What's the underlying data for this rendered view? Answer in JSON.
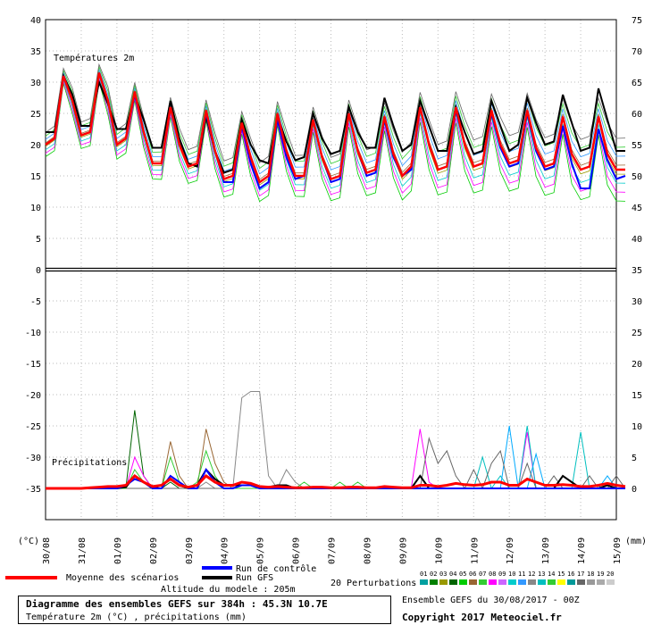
{
  "chart_data": [
    {
      "type": "line",
      "title": "Températures 2m",
      "ylabel_left": "(°C)",
      "ylim": [
        0,
        40
      ],
      "yticks_left": [
        0,
        5,
        10,
        15,
        20,
        25,
        30,
        35,
        40
      ],
      "x": [
        "30/08",
        "31/08",
        "01/09",
        "02/09",
        "03/09",
        "04/09",
        "05/09",
        "06/09",
        "07/09",
        "08/09",
        "09/09",
        "10/09",
        "11/09",
        "12/09",
        "13/09",
        "14/09",
        "15/09"
      ],
      "step_hours": 6,
      "series": [
        {
          "name": "Moyenne des scénarios",
          "color": "#ff0000",
          "values": [
            20,
            21,
            31,
            27,
            21.5,
            22,
            31.5,
            27,
            20,
            21,
            28.5,
            22,
            17,
            17,
            26,
            20,
            16.5,
            17,
            25.5,
            19,
            14.5,
            15,
            23.5,
            18,
            14,
            15,
            25,
            19,
            15,
            15,
            24,
            18,
            14.5,
            15,
            25,
            19,
            15.5,
            16,
            24.5,
            18.5,
            15,
            16.5,
            26,
            20,
            16,
            16.5,
            26,
            20,
            16.5,
            17,
            25.5,
            20,
            17,
            17.5,
            25.5,
            19.5,
            16.5,
            17,
            24.5,
            18.5,
            16,
            16.5,
            24.5,
            18.5,
            16,
            16
          ]
        },
        {
          "name": "Run de contrôle",
          "color": "#0000ff",
          "values": [
            20,
            21,
            31,
            27,
            21.5,
            22,
            31.5,
            27,
            20,
            21,
            28,
            22,
            17,
            17,
            26,
            20,
            16.5,
            17,
            25,
            19,
            14,
            14,
            23,
            17,
            13,
            14,
            24,
            18,
            14.5,
            15,
            24,
            18,
            14,
            14.5,
            25,
            19,
            15,
            15.5,
            24,
            18,
            15,
            16,
            26,
            20,
            16,
            16.5,
            25.5,
            20,
            16.5,
            17,
            25,
            19.5,
            16.5,
            17,
            25,
            19,
            16,
            16.5,
            23,
            17,
            13,
            13,
            22.5,
            17.5,
            14.5,
            15
          ]
        },
        {
          "name": "Run GFS",
          "color": "#000000",
          "values": [
            22,
            22,
            31,
            28,
            23,
            23,
            30,
            26.5,
            22.5,
            22.5,
            28,
            24,
            19.5,
            19.5,
            27,
            21,
            17,
            16.5,
            24.5,
            19,
            15.5,
            16,
            24,
            20,
            17.5,
            17,
            24.5,
            20.5,
            17.5,
            18,
            25,
            21,
            18.5,
            19,
            26,
            22,
            19.5,
            19.5,
            27.5,
            23,
            19,
            20,
            27,
            23,
            19,
            19,
            26,
            22,
            18.5,
            19,
            27,
            23,
            19,
            20,
            27.5,
            23.5,
            20,
            20.5,
            28,
            23.5,
            19,
            19.5,
            29,
            24,
            19,
            19
          ]
        }
      ]
    },
    {
      "type": "line",
      "title": "Précipitations",
      "ylabel_right": "(mm)",
      "ylim": [
        0,
        35
      ],
      "yticks_right": [
        0,
        5,
        10,
        15,
        20,
        25,
        30,
        35
      ],
      "series": [
        {
          "name": "Moyenne des scénarios",
          "color": "#ff0000",
          "values": [
            0,
            0,
            0,
            0,
            0,
            0.1,
            0.2,
            0.3,
            0.3,
            0.5,
            2,
            1,
            0.3,
            0.5,
            1.5,
            0.5,
            0.2,
            0.5,
            2,
            1,
            0.5,
            0.5,
            1,
            0.8,
            0.3,
            0.2,
            0.3,
            0.2,
            0.1,
            0.1,
            0.2,
            0.2,
            0.1,
            0.1,
            0.2,
            0.2,
            0.1,
            0.1,
            0.3,
            0.2,
            0.1,
            0.1,
            0.5,
            0.5,
            0.3,
            0.5,
            0.8,
            0.6,
            0.5,
            0.6,
            1,
            1,
            0.5,
            0.5,
            1.5,
            1,
            0.5,
            0.5,
            0.6,
            0.5,
            0.3,
            0.3,
            0.5,
            0.8,
            0.5,
            0.3
          ]
        },
        {
          "name": "Run de contrôle",
          "color": "#0000ff",
          "values": [
            0,
            0,
            0,
            0,
            0,
            0,
            0,
            0,
            0,
            0.5,
            1.5,
            1,
            0,
            0,
            2,
            1,
            0,
            0,
            3,
            1,
            0,
            0,
            0.5,
            0.5,
            0,
            0,
            0,
            0,
            0,
            0,
            0,
            0,
            0,
            0,
            0,
            0,
            0,
            0,
            0,
            0,
            0,
            0,
            0,
            0,
            0,
            0,
            0,
            0,
            0,
            0,
            0,
            0,
            0,
            0,
            0,
            0,
            0,
            0,
            0,
            0,
            0,
            0,
            0,
            0,
            0,
            0
          ]
        },
        {
          "name": "Run GFS",
          "color": "#000000",
          "values": [
            0,
            0,
            0,
            0,
            0,
            0,
            0,
            0,
            0,
            0.2,
            2,
            1,
            0,
            0.5,
            1.5,
            0.5,
            0,
            0.5,
            3,
            1.5,
            0.5,
            0.5,
            0.5,
            0.5,
            0.3,
            0.2,
            0.5,
            0.5,
            0,
            0,
            0,
            0,
            0,
            0,
            0,
            0,
            0,
            0,
            0,
            0,
            0,
            0,
            2,
            0,
            0,
            0,
            0,
            0,
            0,
            0,
            0,
            0,
            0,
            0,
            0,
            0,
            0,
            0,
            2,
            1,
            0,
            0,
            0,
            0.5,
            0,
            0
          ]
        },
        {
          "name": "Perturbation 12",
          "color": "#888888",
          "values": [
            0,
            0,
            0,
            0,
            0,
            0,
            0,
            0,
            0,
            0,
            0,
            0,
            0,
            0,
            0,
            0,
            0,
            0,
            1,
            0,
            0,
            0,
            14.5,
            15.5,
            15.5,
            2,
            0,
            3,
            1,
            0,
            0,
            0,
            0,
            0,
            0,
            0,
            0,
            0,
            0,
            0,
            0,
            0,
            0,
            0,
            0,
            0,
            0,
            0,
            0,
            0,
            0,
            0,
            0,
            0,
            0,
            0,
            0,
            0,
            0,
            0,
            0,
            0,
            0,
            0,
            0,
            0
          ]
        },
        {
          "name": "Perturbation 02",
          "color": "#006400",
          "values": [
            0,
            0,
            0,
            0,
            0,
            0,
            0,
            0,
            0,
            0,
            12.5,
            2,
            0,
            0,
            1,
            0,
            0,
            0,
            0,
            0,
            0,
            0,
            0,
            0,
            0,
            0,
            0,
            0,
            0,
            0,
            0,
            0,
            0,
            0,
            0,
            0,
            0,
            0,
            0,
            0,
            0,
            0,
            0,
            0,
            0,
            0,
            0,
            0,
            0,
            0,
            0,
            0,
            0,
            0,
            0,
            0,
            0,
            0,
            0,
            0,
            0,
            0,
            0,
            0,
            0,
            0
          ]
        },
        {
          "name": "Perturbation 04",
          "color": "#996633",
          "values": [
            0,
            0,
            0,
            0,
            0,
            0,
            0,
            0,
            0,
            0,
            2,
            1,
            0,
            0,
            7.5,
            2,
            0,
            0,
            9.5,
            4,
            1,
            0,
            0,
            0,
            0,
            0,
            0,
            0,
            0,
            0,
            0,
            0,
            0,
            0,
            0,
            0,
            0,
            0,
            0,
            0,
            0,
            0,
            0,
            0,
            0,
            0,
            0,
            0,
            0,
            0,
            0,
            0,
            0,
            0,
            0,
            0,
            0,
            0,
            0,
            0,
            0,
            0,
            0,
            0,
            0,
            0
          ]
        },
        {
          "name": "Perturbation 08",
          "color": "#ff00ff",
          "values": [
            0,
            0,
            0,
            0,
            0,
            0,
            0,
            0,
            0,
            0,
            5,
            2,
            0,
            0,
            0,
            0,
            0,
            0,
            0,
            0,
            0,
            0,
            0,
            0,
            0,
            0,
            0,
            0,
            0,
            0,
            0,
            0,
            0,
            0,
            0,
            0,
            0,
            0,
            0,
            0,
            0,
            0,
            9.5,
            1,
            0,
            0,
            0,
            0,
            0,
            0,
            0,
            0,
            0,
            0,
            9,
            0,
            0,
            0,
            0,
            0,
            0,
            0,
            0,
            0,
            0,
            0
          ]
        },
        {
          "name": "Perturbation 13",
          "color": "#00bfbf",
          "values": [
            0,
            0,
            0,
            0,
            0,
            0,
            0,
            0,
            0,
            0,
            0,
            0,
            0,
            0,
            0,
            0,
            0,
            0,
            0,
            0,
            0,
            0,
            0,
            0,
            0,
            0,
            0,
            0,
            0,
            0,
            0,
            0,
            0,
            0,
            0,
            0,
            0,
            0,
            0,
            0,
            0,
            0,
            0,
            0,
            0,
            0,
            0,
            0,
            0,
            5,
            0,
            2,
            0,
            0,
            10,
            0,
            0,
            0,
            0,
            0,
            9,
            0,
            0,
            0,
            0,
            0
          ]
        },
        {
          "name": "Perturbation 11",
          "color": "#00aaff",
          "values": [
            0,
            0,
            0,
            0,
            0,
            0,
            0,
            0,
            0,
            0,
            0,
            0,
            0,
            0,
            0,
            0,
            0,
            0,
            0,
            0,
            0,
            0,
            0,
            0,
            0,
            0,
            0,
            0,
            0,
            0,
            0,
            0,
            0,
            0,
            0,
            0,
            0,
            0,
            0,
            0,
            0,
            0,
            0,
            0,
            0,
            0,
            0,
            0,
            0,
            0,
            0,
            0,
            10,
            0,
            0,
            5.5,
            0,
            0,
            0,
            0,
            0,
            0,
            0,
            2,
            0,
            0
          ]
        },
        {
          "name": "Perturbation 17",
          "color": "#666666",
          "values": [
            0,
            0,
            0,
            0,
            0,
            0,
            0,
            0,
            0,
            0,
            0,
            0,
            0,
            0,
            0,
            0,
            0,
            0,
            0,
            0,
            0,
            0,
            0,
            0,
            0,
            0,
            0,
            0,
            0,
            0,
            0,
            0,
            0,
            0,
            0,
            0,
            0,
            0,
            0,
            0,
            0,
            0,
            0,
            8,
            4,
            6,
            2,
            0,
            3,
            0,
            4,
            6,
            0,
            0,
            4,
            0,
            0,
            2,
            0,
            0,
            0,
            2,
            0,
            0,
            2,
            0
          ]
        },
        {
          "name": "Perturbation 14",
          "color": "#33cc33",
          "values": [
            0,
            0,
            0,
            0,
            0,
            0,
            0,
            0,
            0,
            0,
            3,
            1,
            0,
            0,
            5,
            1,
            0,
            1,
            6,
            2,
            0,
            0,
            0,
            0,
            0,
            0,
            0,
            0,
            0,
            1,
            0,
            0,
            0,
            1,
            0,
            1,
            0,
            0,
            0,
            0,
            0,
            0,
            0,
            0,
            0,
            0,
            0,
            0,
            0,
            0,
            0,
            0,
            0,
            0,
            0,
            0,
            0,
            0,
            0,
            0,
            0,
            0,
            0,
            0,
            0,
            0
          ]
        }
      ]
    }
  ],
  "labels": {
    "temp_title": "Températures 2m",
    "precip_title": "Précipitations",
    "unit_left": "(°C)",
    "unit_right": "(mm)",
    "left_ticks": [
      "40",
      "35",
      "30",
      "25",
      "20",
      "15",
      "10",
      "5",
      "0",
      "-5",
      "-10",
      "-15",
      "-20",
      "-25",
      "-30",
      "-35"
    ],
    "right_ticks": [
      "75",
      "70",
      "65",
      "60",
      "55",
      "50",
      "45",
      "40",
      "35",
      "30",
      "25",
      "20",
      "15",
      "10",
      "5",
      "0"
    ],
    "dates": [
      "30/08",
      "31/08",
      "01/09",
      "02/09",
      "03/09",
      "04/09",
      "05/09",
      "06/09",
      "07/09",
      "08/09",
      "09/09",
      "10/09",
      "11/09",
      "12/09",
      "13/09",
      "14/09",
      "15/09"
    ]
  },
  "legend": {
    "mean": "Moyenne des scénarios",
    "control": "Run de contrôle",
    "gfs": "Run GFS",
    "altitude": "Altitude du modele : 205m",
    "perturbations": "20 Perturbations",
    "pert_numbers": [
      "01",
      "02",
      "03",
      "04",
      "05",
      "06",
      "07",
      "08",
      "09",
      "10",
      "11",
      "12",
      "13",
      "14",
      "15",
      "16",
      "17",
      "18",
      "19",
      "20"
    ],
    "pert_colors": [
      "#00a0a0",
      "#008000",
      "#999900",
      "#006400",
      "#00cc00",
      "#996633",
      "#33cc33",
      "#ff00ff",
      "#cc66ff",
      "#00cccc",
      "#3399ff",
      "#888888",
      "#00bfbf",
      "#33cc33",
      "#ffff00",
      "#009999",
      "#666666",
      "#999999",
      "#aaaaaa",
      "#cccccc"
    ]
  },
  "footer": {
    "title": "Diagramme des ensembles GEFS sur 384h : 45.3N 10.7E",
    "subtitle": "Température 2m (°C) , précipitations (mm)",
    "ensemble": "Ensemble GEFS du 30/08/2017 - 00Z",
    "copyright": "Copyright 2017 Meteociel.fr"
  }
}
